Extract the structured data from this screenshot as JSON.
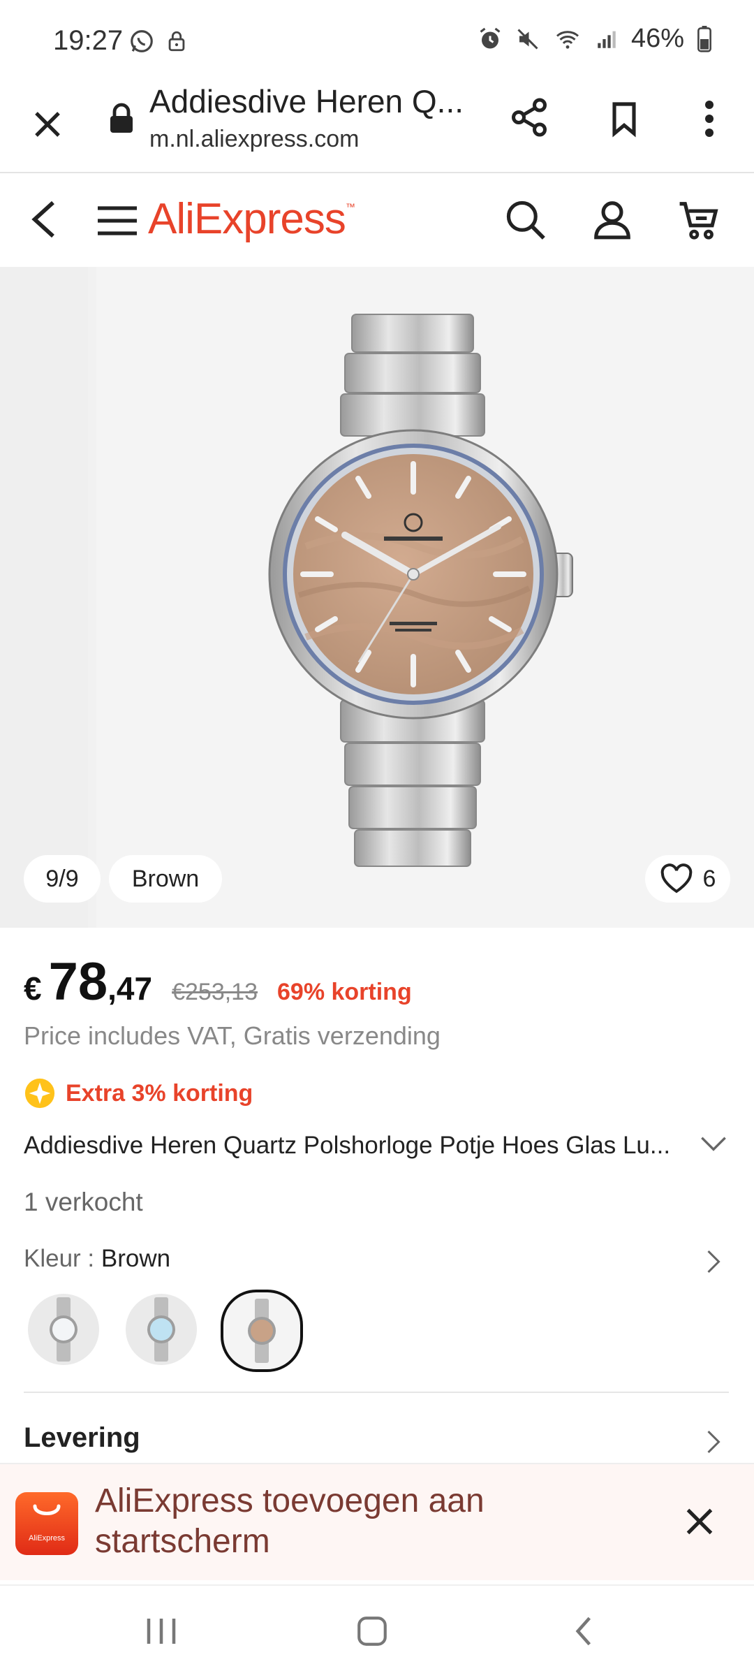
{
  "status_bar": {
    "time": "19:27",
    "battery": "46%"
  },
  "browser": {
    "title": "Addiesdive Heren Q...",
    "url": "m.nl.aliexpress.com"
  },
  "app_header": {
    "logo": "AliExpress"
  },
  "gallery": {
    "counter": "9/9",
    "color_label": "Brown",
    "wishlist_count": "6"
  },
  "price": {
    "currency": "€",
    "integer": "78",
    "decimal": ",47",
    "original": "€253,13",
    "discount": "69% korting",
    "vat_note": "Price includes VAT, Gratis verzending",
    "extra": "Extra 3% korting"
  },
  "product": {
    "title": "Addiesdive Heren Quartz Polshorloge Potje Hoes Glas Lu...",
    "sold": "1 verkocht",
    "color_label": "Kleur : ",
    "color_value": "Brown",
    "variants": [
      {
        "dial": "#f3f5f7",
        "selected": false
      },
      {
        "dial": "#bfe2f2",
        "selected": false
      },
      {
        "dial": "#c8a287",
        "selected": true
      }
    ]
  },
  "delivery": {
    "label": "Levering"
  },
  "banner": {
    "text": "AliExpress toevoegen aan startscherm",
    "icon_label": "AliExpress"
  },
  "colors": {
    "brand": "#e8432a",
    "dial": "#c8a287"
  }
}
